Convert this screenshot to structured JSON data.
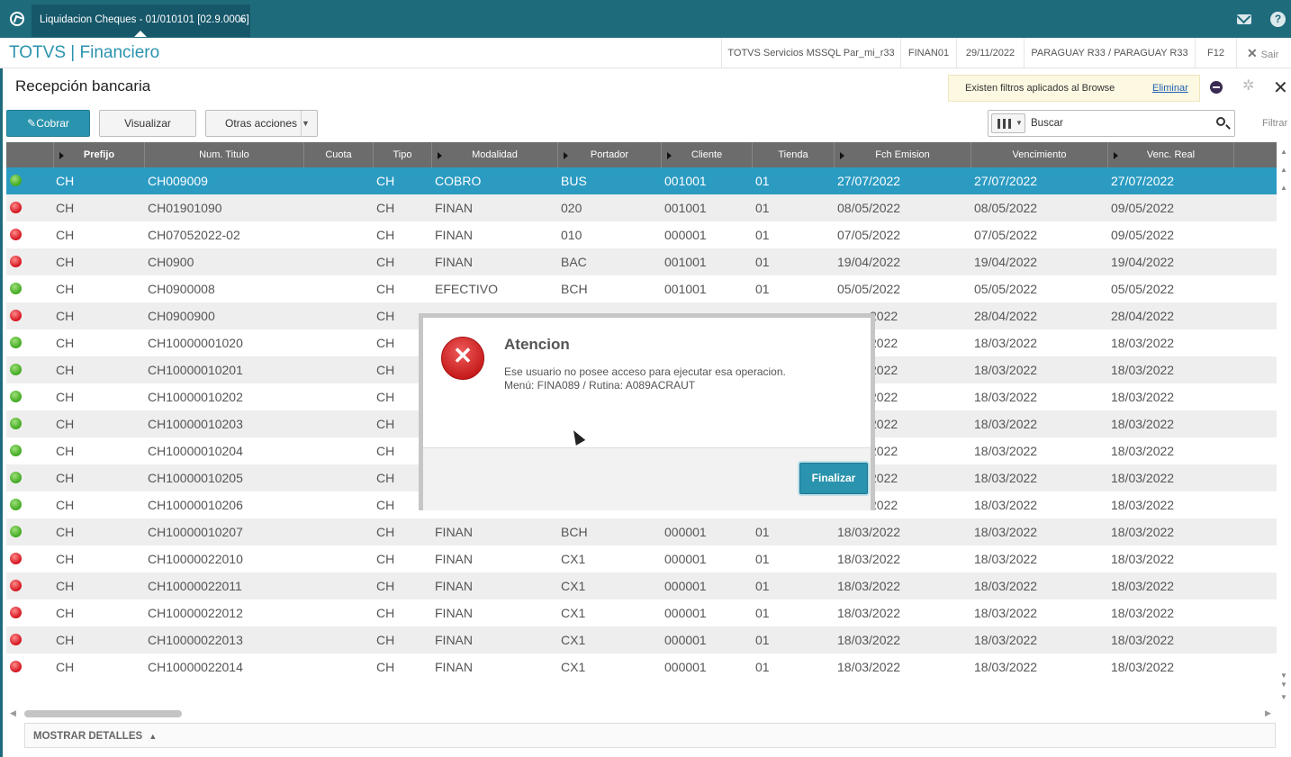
{
  "window": {
    "tab_title": "Liquidacion Cheques - 01/010101 [02.9.0006]",
    "tab_close": "×"
  },
  "header": {
    "brand": "TOTVS | Financiero",
    "server": "TOTVS Servicios MSSQL Par_mi_r33",
    "user": "FINAN01",
    "date": "29/11/2022",
    "company": "PARAGUAY R33 / PARAGUAY R33",
    "key": "F12",
    "exit_label": "Sair"
  },
  "page": {
    "title": "Recepción bancaria"
  },
  "filter_notice": {
    "text": "Existen filtros aplicados al Browse",
    "link": "Eliminar"
  },
  "toolbar": {
    "cobrar": "Cobrar",
    "visualizar": "Visualizar",
    "otras": "Otras acciones",
    "search_placeholder": "Buscar",
    "filtrar": "Filtrar"
  },
  "grid": {
    "columns": [
      "Prefijo",
      "Num. Titulo",
      "Cuota",
      "Tipo",
      "Modalidad",
      "Portador",
      "Cliente",
      "Tienda",
      "Fch Emision",
      "Vencimiento",
      "Venc. Real"
    ],
    "rows": [
      {
        "status": "green",
        "prefijo": "CH",
        "num": "CH009009",
        "cuota": "",
        "tipo": "CH",
        "modalidad": "COBRO",
        "portador": "BUS",
        "cliente": "001001",
        "tienda": "01",
        "emision": "27/07/2022",
        "venc": "27/07/2022",
        "vreal": "27/07/2022"
      },
      {
        "status": "red",
        "prefijo": "CH",
        "num": "CH01901090",
        "cuota": "",
        "tipo": "CH",
        "modalidad": "FINAN",
        "portador": "020",
        "cliente": "001001",
        "tienda": "01",
        "emision": "08/05/2022",
        "venc": "08/05/2022",
        "vreal": "09/05/2022"
      },
      {
        "status": "red",
        "prefijo": "CH",
        "num": "CH07052022-02",
        "cuota": "",
        "tipo": "CH",
        "modalidad": "FINAN",
        "portador": "010",
        "cliente": "000001",
        "tienda": "01",
        "emision": "07/05/2022",
        "venc": "07/05/2022",
        "vreal": "09/05/2022"
      },
      {
        "status": "red",
        "prefijo": "CH",
        "num": "CH0900",
        "cuota": "",
        "tipo": "CH",
        "modalidad": "FINAN",
        "portador": "BAC",
        "cliente": "001001",
        "tienda": "01",
        "emision": "19/04/2022",
        "venc": "19/04/2022",
        "vreal": "19/04/2022"
      },
      {
        "status": "green",
        "prefijo": "CH",
        "num": "CH0900008",
        "cuota": "",
        "tipo": "CH",
        "modalidad": "EFECTIVO",
        "portador": "BCH",
        "cliente": "001001",
        "tienda": "01",
        "emision": "05/05/2022",
        "venc": "05/05/2022",
        "vreal": "05/05/2022"
      },
      {
        "status": "red",
        "prefijo": "CH",
        "num": "CH0900900",
        "cuota": "",
        "tipo": "CH",
        "modalidad": "",
        "portador": "",
        "cliente": "",
        "tienda": "",
        "emision": "2022",
        "venc": "28/04/2022",
        "vreal": "28/04/2022"
      },
      {
        "status": "green",
        "prefijo": "CH",
        "num": "CH10000001020",
        "cuota": "",
        "tipo": "CH",
        "modalidad": "",
        "portador": "",
        "cliente": "",
        "tienda": "",
        "emision": "2022",
        "venc": "18/03/2022",
        "vreal": "18/03/2022"
      },
      {
        "status": "green",
        "prefijo": "CH",
        "num": "CH10000010201",
        "cuota": "",
        "tipo": "CH",
        "modalidad": "",
        "portador": "",
        "cliente": "",
        "tienda": "",
        "emision": "2022",
        "venc": "18/03/2022",
        "vreal": "18/03/2022"
      },
      {
        "status": "green",
        "prefijo": "CH",
        "num": "CH10000010202",
        "cuota": "",
        "tipo": "CH",
        "modalidad": "",
        "portador": "",
        "cliente": "",
        "tienda": "",
        "emision": "2022",
        "venc": "18/03/2022",
        "vreal": "18/03/2022"
      },
      {
        "status": "green",
        "prefijo": "CH",
        "num": "CH10000010203",
        "cuota": "",
        "tipo": "CH",
        "modalidad": "",
        "portador": "",
        "cliente": "",
        "tienda": "",
        "emision": "2022",
        "venc": "18/03/2022",
        "vreal": "18/03/2022"
      },
      {
        "status": "green",
        "prefijo": "CH",
        "num": "CH10000010204",
        "cuota": "",
        "tipo": "CH",
        "modalidad": "",
        "portador": "",
        "cliente": "",
        "tienda": "",
        "emision": "2022",
        "venc": "18/03/2022",
        "vreal": "18/03/2022"
      },
      {
        "status": "green",
        "prefijo": "CH",
        "num": "CH10000010205",
        "cuota": "",
        "tipo": "CH",
        "modalidad": "",
        "portador": "",
        "cliente": "",
        "tienda": "",
        "emision": "2022",
        "venc": "18/03/2022",
        "vreal": "18/03/2022"
      },
      {
        "status": "green",
        "prefijo": "CH",
        "num": "CH10000010206",
        "cuota": "",
        "tipo": "CH",
        "modalidad": "",
        "portador": "",
        "cliente": "",
        "tienda": "",
        "emision": "2022",
        "venc": "18/03/2022",
        "vreal": "18/03/2022"
      },
      {
        "status": "green",
        "prefijo": "CH",
        "num": "CH10000010207",
        "cuota": "",
        "tipo": "CH",
        "modalidad": "FINAN",
        "portador": "BCH",
        "cliente": "000001",
        "tienda": "01",
        "emision": "18/03/2022",
        "venc": "18/03/2022",
        "vreal": "18/03/2022"
      },
      {
        "status": "red",
        "prefijo": "CH",
        "num": "CH10000022010",
        "cuota": "",
        "tipo": "CH",
        "modalidad": "FINAN",
        "portador": "CX1",
        "cliente": "000001",
        "tienda": "01",
        "emision": "18/03/2022",
        "venc": "18/03/2022",
        "vreal": "18/03/2022"
      },
      {
        "status": "red",
        "prefijo": "CH",
        "num": "CH10000022011",
        "cuota": "",
        "tipo": "CH",
        "modalidad": "FINAN",
        "portador": "CX1",
        "cliente": "000001",
        "tienda": "01",
        "emision": "18/03/2022",
        "venc": "18/03/2022",
        "vreal": "18/03/2022"
      },
      {
        "status": "red",
        "prefijo": "CH",
        "num": "CH10000022012",
        "cuota": "",
        "tipo": "CH",
        "modalidad": "FINAN",
        "portador": "CX1",
        "cliente": "000001",
        "tienda": "01",
        "emision": "18/03/2022",
        "venc": "18/03/2022",
        "vreal": "18/03/2022"
      },
      {
        "status": "red",
        "prefijo": "CH",
        "num": "CH10000022013",
        "cuota": "",
        "tipo": "CH",
        "modalidad": "FINAN",
        "portador": "CX1",
        "cliente": "000001",
        "tienda": "01",
        "emision": "18/03/2022",
        "venc": "18/03/2022",
        "vreal": "18/03/2022"
      },
      {
        "status": "red",
        "prefijo": "CH",
        "num": "CH10000022014",
        "cuota": "",
        "tipo": "CH",
        "modalidad": "FINAN",
        "portador": "CX1",
        "cliente": "000001",
        "tienda": "01",
        "emision": "18/03/2022",
        "venc": "18/03/2022",
        "vreal": "18/03/2022"
      }
    ],
    "selected_row": 0
  },
  "footer": {
    "details": "MOSTRAR DETALLES"
  },
  "dialog": {
    "title": "Atencion",
    "message_line1": "Ese usuario no posee acceso para ejecutar esa operacion.",
    "message_line2": "Menú: FINA089 / Rutina: A089ACRAUT",
    "button": "Finalizar",
    "icon": "error-x-icon"
  },
  "colors": {
    "accent": "#2a93ae",
    "topbar": "#1e6b7c",
    "selected_row": "#2b9bc2",
    "status_green": "#3fa81e",
    "status_red": "#d4121c"
  }
}
